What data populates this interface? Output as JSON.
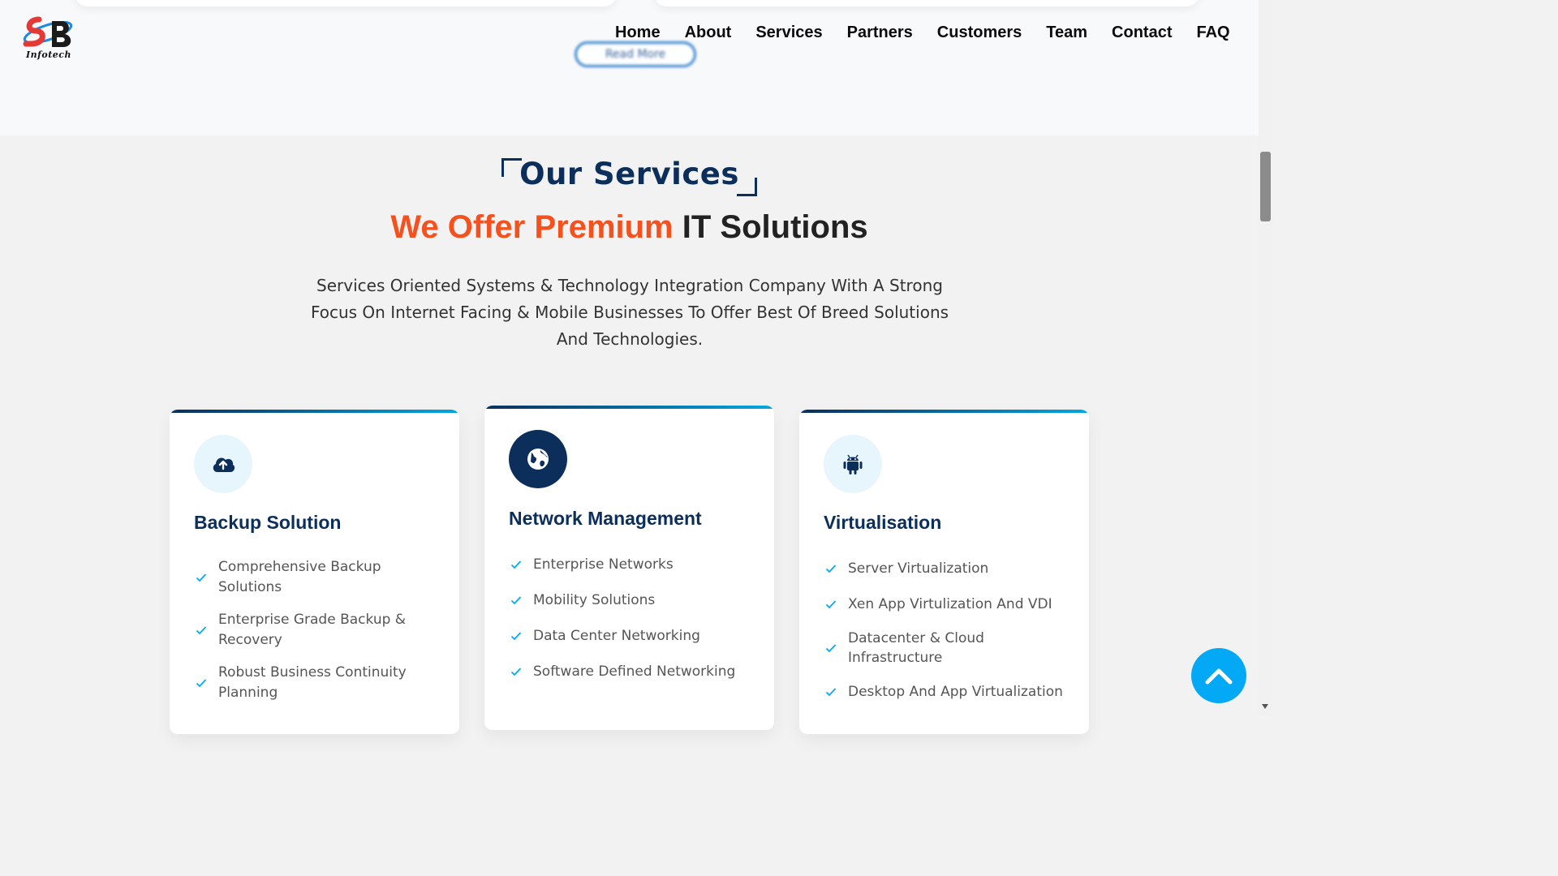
{
  "hero": {
    "read_more_label": "Read More"
  },
  "header": {
    "logo_text": "Infotech",
    "nav": [
      "Home",
      "About",
      "Services",
      "Partners",
      "Customers",
      "Team",
      "Contact",
      "FAQ"
    ]
  },
  "services": {
    "label": "Our Services",
    "headline_accent": "We Offer Premium",
    "headline_rest": "IT Solutions",
    "intro": "Services Oriented Systems & Technology Integration Company With A Strong Focus On Internet Facing & Mobile Businesses To Offer Best Of Breed Solutions And Technologies.",
    "cards": [
      {
        "title": "Backup Solution",
        "icon": "cloud-upload-icon",
        "items": [
          "Comprehensive Backup Solutions",
          "Enterprise Grade Backup & Recovery",
          "Robust Business Continuity Planning"
        ]
      },
      {
        "title": "Network Management",
        "icon": "globe-icon",
        "items": [
          "Enterprise Networks",
          "Mobility Solutions",
          "Data Center Networking",
          "Software Defined Networking"
        ]
      },
      {
        "title": "Virtualisation",
        "icon": "android-icon",
        "items": [
          "Server Virtualization",
          "Xen App Virtulization And VDI",
          "Datacenter & Cloud Infrastructure",
          "Desktop And App Virtualization"
        ]
      }
    ]
  },
  "colors": {
    "navy": "#0b2e5a",
    "accent_orange": "#f4511e",
    "check_blue": "#03a9f4"
  }
}
